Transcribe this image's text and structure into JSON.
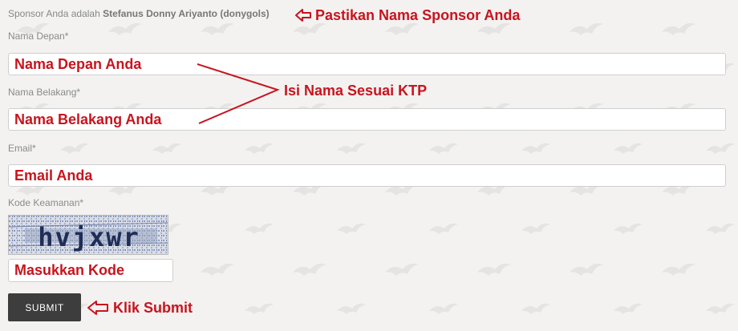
{
  "sponsor": {
    "prefix": "Sponsor Anda adalah",
    "name": "Stefanus Donny Ariyanto (donygols)"
  },
  "form": {
    "first_name": {
      "label": "Nama Depan*",
      "value": "Nama Depan Anda"
    },
    "last_name": {
      "label": "Nama Belakang*",
      "value": "Nama Belakang Anda"
    },
    "email": {
      "label": "Email*",
      "value": "Email Anda"
    },
    "security_code": {
      "label": "Kode Keamanan*",
      "captcha_text": "hvjxwr",
      "value": "Masukkan Kode"
    },
    "submit_label": "SUBMIT"
  },
  "annotations": {
    "sponsor_note": "Pastikan Nama Sponsor Anda",
    "name_note": "Isi Nama Sesuai KTP",
    "submit_note": "Klik Submit"
  },
  "colors": {
    "annotation": "#c8141e",
    "button": "#3d3d3d",
    "background": "#f3f2f1"
  }
}
